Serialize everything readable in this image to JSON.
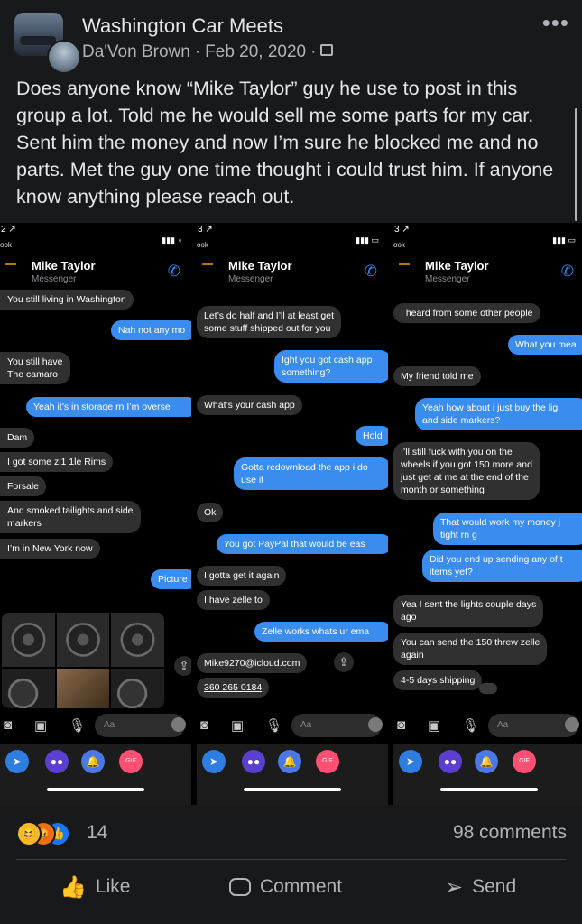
{
  "post": {
    "group_name": "Washington Car Meets",
    "author": "Da'Von Brown",
    "date": "Feb 20, 2020",
    "separator": "·",
    "privacy_icon": "group-members-icon",
    "more_label": "•••",
    "text": "Does anyone know “Mike Taylor” guy he use to post in this group a lot. Told me he would sell me some parts for my car. Sent him the money and now I’m sure he blocked me and no parts. Met the guy one time thought i could trust him. If anyone know anything please reach out."
  },
  "screenshots": [
    {
      "status_time": "2 ↗",
      "status_app": "ook",
      "contact": "Mike Taylor",
      "contact_sub": "Messenger",
      "messages": [
        {
          "dir": "in",
          "text": "You still living in Washington"
        },
        {
          "dir": "out",
          "text": "Nah not any mo"
        },
        {
          "dir": "in",
          "text": "You still have\nThe camaro"
        },
        {
          "dir": "out",
          "text": "Yeah it’s in storage rn I’m overse"
        },
        {
          "dir": "in",
          "text": "Dam"
        },
        {
          "dir": "in",
          "text": "I got some zl1 1le Rims"
        },
        {
          "dir": "in",
          "text": "Forsale"
        },
        {
          "dir": "in",
          "text": "And smoked tailights and side\nmarkers"
        },
        {
          "dir": "in",
          "text": "I’m in New York now"
        },
        {
          "dir": "out",
          "text": "Picture"
        }
      ],
      "composer_placeholder": "Aa"
    },
    {
      "status_time": "3 ↗",
      "status_app": "ook",
      "contact": "Mike Taylor",
      "contact_sub": "Messenger",
      "messages": [
        {
          "dir": "in",
          "text": "Let’s do half and I’ll at least get\nsome stuff shipped out for you"
        },
        {
          "dir": "out",
          "text": "Ight you got cash app\nsomething?"
        },
        {
          "dir": "in",
          "text": "What’s your cash app"
        },
        {
          "dir": "out",
          "text": "Hold"
        },
        {
          "dir": "out",
          "text": "Gotta redownload the app i do\nuse it"
        },
        {
          "dir": "in",
          "text": "Ok"
        },
        {
          "dir": "out",
          "text": "You got PayPal that would be eas"
        },
        {
          "dir": "in",
          "text": "I gotta get it again"
        },
        {
          "dir": "in",
          "text": "I have zelle to"
        },
        {
          "dir": "out",
          "text": "Zelle works whats ur ema"
        },
        {
          "dir": "in",
          "text": "Mike9270@icloud.com"
        },
        {
          "dir": "in",
          "text": "360 265 0184"
        }
      ],
      "composer_placeholder": "Aa"
    },
    {
      "status_time": "3 ↗",
      "status_app": "ook",
      "contact": "Mike Taylor",
      "contact_sub": "Messenger",
      "messages": [
        {
          "dir": "in",
          "text": "I heard from some other people"
        },
        {
          "dir": "out",
          "text": "What you mea"
        },
        {
          "dir": "in",
          "text": "My friend told me"
        },
        {
          "dir": "out",
          "text": "Yeah how about i just buy the lig\nand side markers?"
        },
        {
          "dir": "in",
          "text": "I’ll still fuck with you on the\nwheels if you got 150 more and\njust get at me at the end of the\nmonth or something"
        },
        {
          "dir": "out",
          "text": "That would work my money j\ntight rn g"
        },
        {
          "dir": "out",
          "text": "Did you end up sending any of t\nitems yet?"
        },
        {
          "dir": "in",
          "text": "Yea I sent the lights couple days\nago"
        },
        {
          "dir": "in",
          "text": "You can send the 150 threw zelle\nagain"
        },
        {
          "dir": "in",
          "text": "4-5 days shipping"
        }
      ],
      "composer_placeholder": "Aa"
    }
  ],
  "footer": {
    "reaction_icons": [
      "haha-icon",
      "angry-icon",
      "like-icon"
    ],
    "reaction_count": "14",
    "comments": "98 comments",
    "like_label": "Like",
    "comment_label": "Comment",
    "send_label": "Send"
  }
}
